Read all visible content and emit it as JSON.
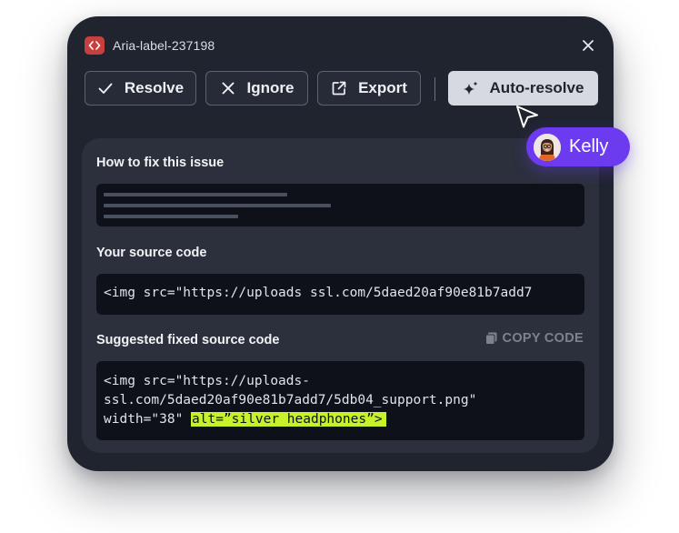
{
  "header": {
    "title": "Aria-label-237198",
    "badge_icon": "code-brackets-icon",
    "close_icon": "close-icon"
  },
  "toolbar": {
    "resolve_label": "Resolve",
    "ignore_label": "Ignore",
    "export_label": "Export",
    "auto_resolve_label": "Auto-resolve"
  },
  "panel": {
    "how_to_fix_label": "How to fix this issue",
    "source_label": "Your source code",
    "source_code": "<img src=\"https://uploads ssl.com/5daed20af90e81b7add7",
    "suggested_label": "Suggested fixed source code",
    "copy_label": "COPY CODE",
    "suggested_lines": [
      "<img src=\"https://uploads-",
      "ssl.com/5daed20af90e81b7add7/5db04_support.png\"",
      "width=\"38\" "
    ],
    "suggested_highlight": "alt=”silver headphones”>"
  },
  "collaborator": {
    "name": "Kelly"
  },
  "colors": {
    "card_bg": "#20242f",
    "panel_bg": "#2b303c",
    "code_bg": "#0f111a",
    "badge_red": "#c7403e",
    "highlight": "#c6f12b",
    "collab_purple": "#6c3bf0"
  }
}
